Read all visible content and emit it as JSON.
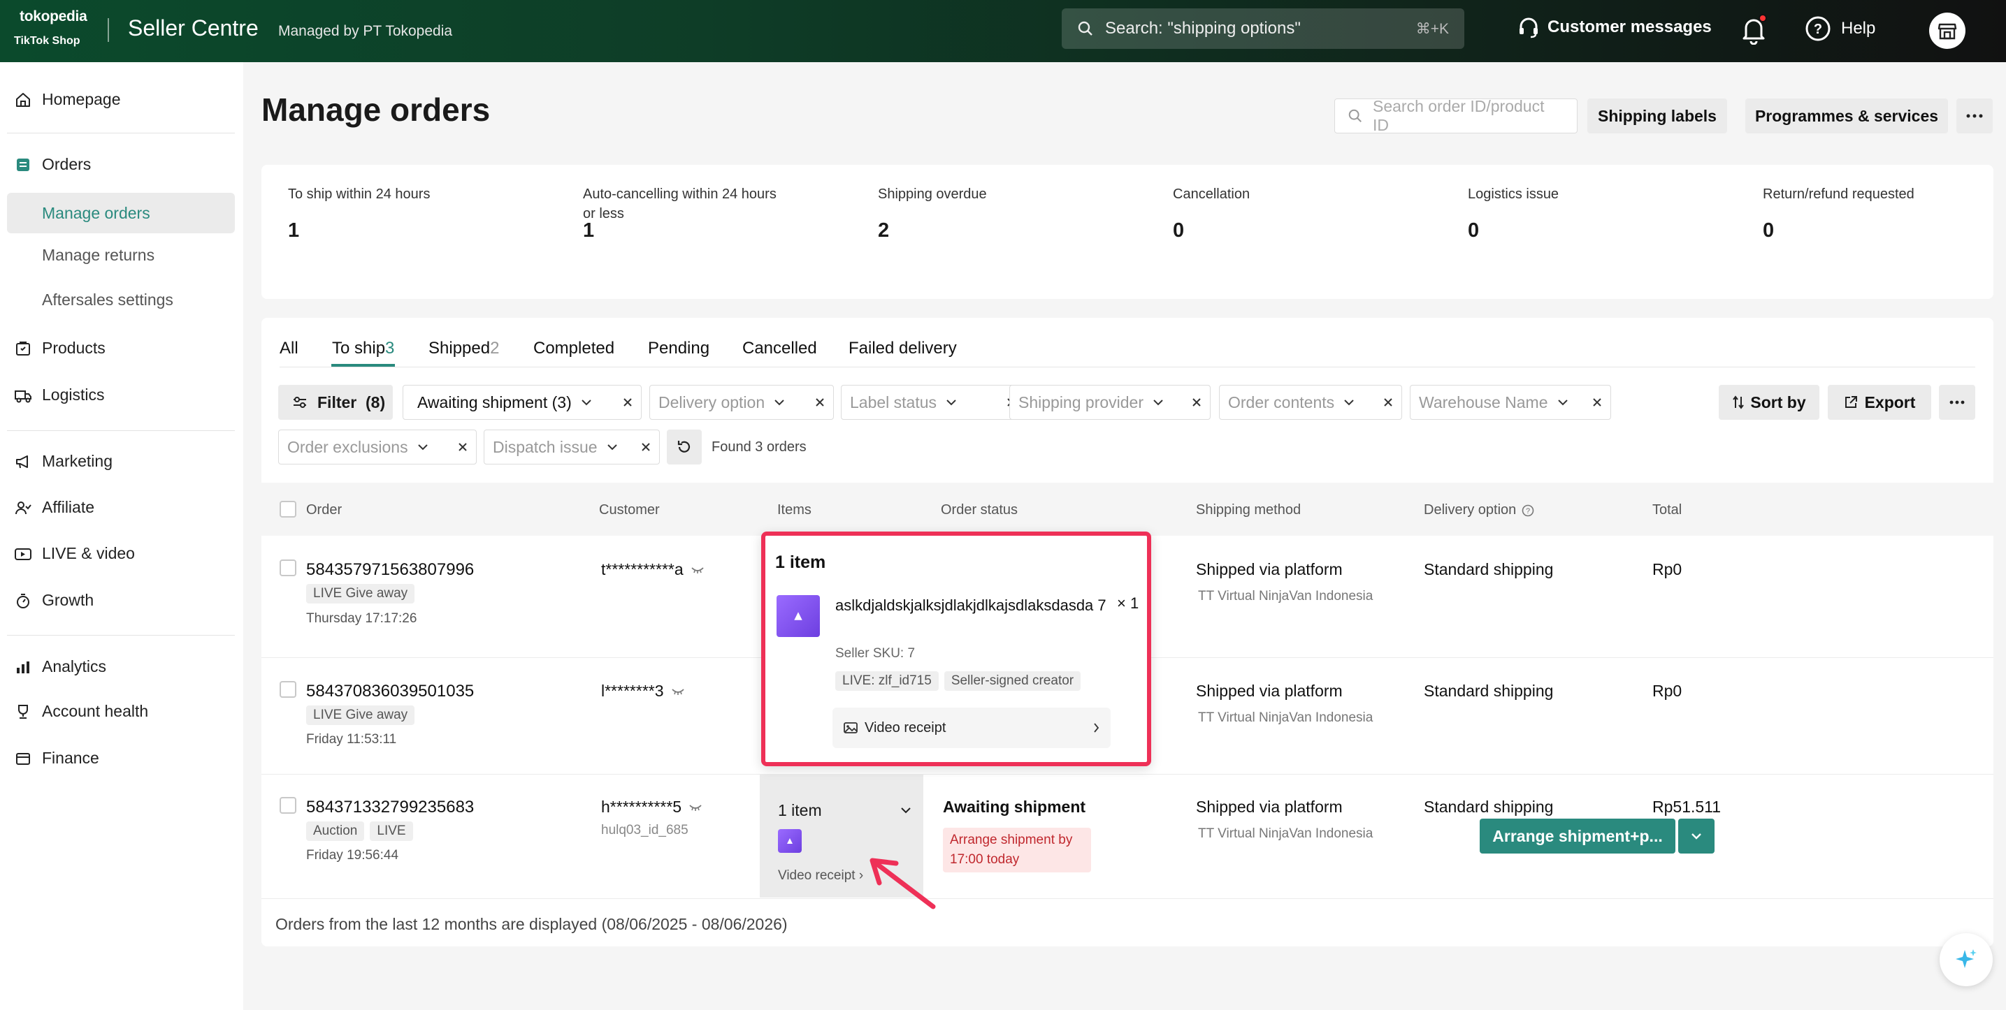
{
  "header": {
    "logo_top": "tokopedia",
    "logo_bottom": "TikTok Shop",
    "title": "Seller Centre",
    "subtitle": "Managed by PT Tokopedia",
    "search_placeholder": "Search: \"shipping options\"",
    "search_shortcut": "⌘+K",
    "customer_messages": "Customer messages",
    "help": "Help"
  },
  "sidebar": {
    "homepage": "Homepage",
    "orders": "Orders",
    "manage_orders": "Manage orders",
    "manage_returns": "Manage returns",
    "aftersales": "Aftersales settings",
    "products": "Products",
    "logistics": "Logistics",
    "marketing": "Marketing",
    "affiliate": "Affiliate",
    "live_video": "LIVE & video",
    "growth": "Growth",
    "analytics": "Analytics",
    "account_health": "Account health",
    "finance": "Finance"
  },
  "page": {
    "title": "Manage orders",
    "order_search_placeholder": "Search order ID/product ID",
    "shipping_labels": "Shipping labels",
    "programmes": "Programmes & services"
  },
  "stats": [
    {
      "label": "To ship within 24 hours",
      "value": "1"
    },
    {
      "label": "Auto-cancelling within 24 hours or less",
      "value": "1"
    },
    {
      "label": "Shipping overdue",
      "value": "2"
    },
    {
      "label": "Cancellation",
      "value": "0"
    },
    {
      "label": "Logistics issue",
      "value": "0"
    },
    {
      "label": "Return/refund requested",
      "value": "0"
    }
  ],
  "tabs": {
    "all": "All",
    "to_ship": "To ship",
    "to_ship_count": "3",
    "shipped": "Shipped",
    "shipped_count": "2",
    "completed": "Completed",
    "pending": "Pending",
    "cancelled": "Cancelled",
    "failed": "Failed delivery"
  },
  "filters": {
    "filter_label": "Filter",
    "filter_count": "(8)",
    "awaiting": "Awaiting shipment (3)",
    "delivery_option": "Delivery option",
    "label_status": "Label status",
    "shipping_provider": "Shipping provider",
    "order_contents": "Order contents",
    "warehouse": "Warehouse Name",
    "order_exclusions": "Order exclusions",
    "dispatch_issue": "Dispatch issue",
    "found": "Found 3 orders",
    "sort_by": "Sort by",
    "export": "Export"
  },
  "columns": {
    "order": "Order",
    "customer": "Customer",
    "items": "Items",
    "order_status": "Order status",
    "shipping_method": "Shipping method",
    "delivery_option": "Delivery option",
    "total": "Total"
  },
  "orders": [
    {
      "id": "584357971563807996",
      "tags": [
        "LIVE Give away"
      ],
      "time": "Thursday 17:17:26",
      "customer": "t***********a",
      "shipping": "Shipped via platform",
      "provider": "TT Virtual NinjaVan Indonesia",
      "delivery": "Standard shipping",
      "total": "Rp0"
    },
    {
      "id": "584370836039501035",
      "tags": [
        "LIVE Give away"
      ],
      "time": "Friday 11:53:11",
      "customer": "l********3",
      "shipping": "Shipped via platform",
      "provider": "TT Virtual NinjaVan Indonesia",
      "delivery": "Standard shipping",
      "total": "Rp0"
    },
    {
      "id": "584371332799235683",
      "tags": [
        "Auction",
        "LIVE"
      ],
      "time": "Friday 19:56:44",
      "customer": "h**********5",
      "customer_sub": "hulq03_id_685",
      "items": "1 item",
      "video_receipt": "Video receipt",
      "status": "Awaiting shipment",
      "status_note": "Arrange shipment by 17:00 today",
      "shipping": "Shipped via platform",
      "provider": "TT Virtual NinjaVan Indonesia",
      "delivery": "Standard shipping",
      "total": "Rp51.511",
      "action": "Arrange shipment+p..."
    }
  ],
  "footer_note": "Orders from the last 12 months are displayed (08/06/2025 - 08/06/2026)",
  "popover": {
    "title": "1 item",
    "product_name": "aslkdjaldskjalksjdlakjdlkajsdlaksdasda 7",
    "qty": "× 1",
    "sku": "Seller SKU: 7",
    "tag_live": "LIVE: zlf_id715",
    "tag_creator": "Seller-signed creator",
    "video_receipt": "Video receipt"
  },
  "colors": {
    "accent": "#2a8a7e",
    "highlight": "#ee3057",
    "alert_bg": "#fde6e6",
    "alert_text": "#c0282e"
  }
}
